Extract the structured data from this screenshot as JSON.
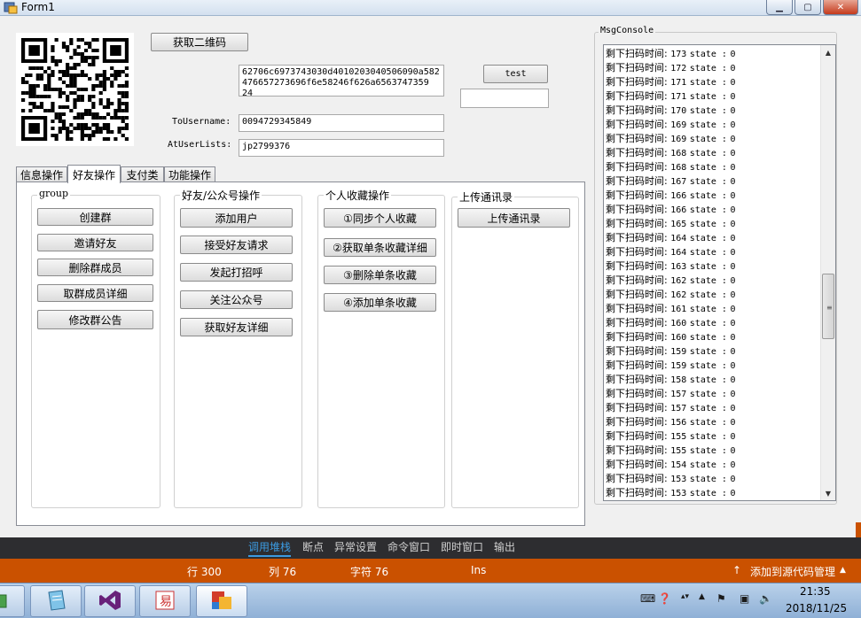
{
  "window": {
    "title": "Form1",
    "min": "▁",
    "max": "▢",
    "close": "✕"
  },
  "buttons": {
    "get_qr": "获取二维码",
    "test": "test"
  },
  "fields": {
    "hex_text_line1": "62706c6973743030d4010203040506090a582",
    "hex_text_line2": "476657273696f6e58246f626a6563747359 24",
    "test_output": "",
    "to_username_label": "ToUsername:",
    "to_username_value": "0094729345849",
    "at_user_lists_label": "AtUserLists:",
    "at_user_lists_value": "jp2799376"
  },
  "tabs": [
    {
      "label": "信息操作"
    },
    {
      "label": "好友操作"
    },
    {
      "label": "支付类"
    },
    {
      "label": "功能操作"
    }
  ],
  "groups": {
    "group": {
      "title": "group",
      "buttons": [
        "创建群",
        "邀请好友",
        "删除群成员",
        "取群成员详细",
        "修改群公告"
      ]
    },
    "friends": {
      "title": "好友/公众号操作",
      "buttons": [
        "添加用户",
        "接受好友请求",
        "发起打招呼",
        "关注公众号",
        "获取好友详细"
      ]
    },
    "favorites": {
      "title": "个人收藏操作",
      "buttons": [
        "①同步个人收藏",
        "②获取单条收藏详细",
        "③删除单条收藏",
        "④添加单条收藏"
      ]
    },
    "contacts": {
      "title": "上传通讯录",
      "buttons": [
        "上传通讯录"
      ]
    }
  },
  "console": {
    "title": "MsgConsole",
    "prefix": "剩下扫码时间:",
    "state_label": "state :",
    "lines": [
      {
        "t": "173",
        "s": "0"
      },
      {
        "t": "172",
        "s": "0"
      },
      {
        "t": "171",
        "s": "0"
      },
      {
        "t": "171",
        "s": "0"
      },
      {
        "t": "170",
        "s": "0"
      },
      {
        "t": "169",
        "s": "0"
      },
      {
        "t": "169",
        "s": "0"
      },
      {
        "t": "168",
        "s": "0"
      },
      {
        "t": "168",
        "s": "0"
      },
      {
        "t": "167",
        "s": "0"
      },
      {
        "t": "166",
        "s": "0"
      },
      {
        "t": "166",
        "s": "0"
      },
      {
        "t": "165",
        "s": "0"
      },
      {
        "t": "164",
        "s": "0"
      },
      {
        "t": "164",
        "s": "0"
      },
      {
        "t": "163",
        "s": "0"
      },
      {
        "t": "162",
        "s": "0"
      },
      {
        "t": "162",
        "s": "0"
      },
      {
        "t": "161",
        "s": "0"
      },
      {
        "t": "160",
        "s": "0"
      },
      {
        "t": "160",
        "s": "0"
      },
      {
        "t": "159",
        "s": "0"
      },
      {
        "t": "159",
        "s": "0"
      },
      {
        "t": "158",
        "s": "0"
      },
      {
        "t": "157",
        "s": "0"
      },
      {
        "t": "157",
        "s": "0"
      },
      {
        "t": "156",
        "s": "0"
      },
      {
        "t": "155",
        "s": "0"
      },
      {
        "t": "155",
        "s": "0"
      },
      {
        "t": "154",
        "s": "0"
      },
      {
        "t": "153",
        "s": "0"
      },
      {
        "t": "153",
        "s": "0"
      }
    ]
  },
  "ide": {
    "tabs": [
      "调用堆栈",
      "断点",
      "异常设置",
      "命令窗口",
      "即时窗口",
      "输出"
    ],
    "status": {
      "line": "行 300",
      "col": "列 76",
      "char": "字符 76",
      "mode": "Ins",
      "source_control": "添加到源代码管理"
    },
    "colors": {
      "status_bar": "#ca5100",
      "tab_strip": "#2d2d30",
      "active_tab": "#3b9ae1"
    }
  },
  "taskbar": {
    "clock_time": "21:35",
    "clock_date": "2018/11/25"
  }
}
